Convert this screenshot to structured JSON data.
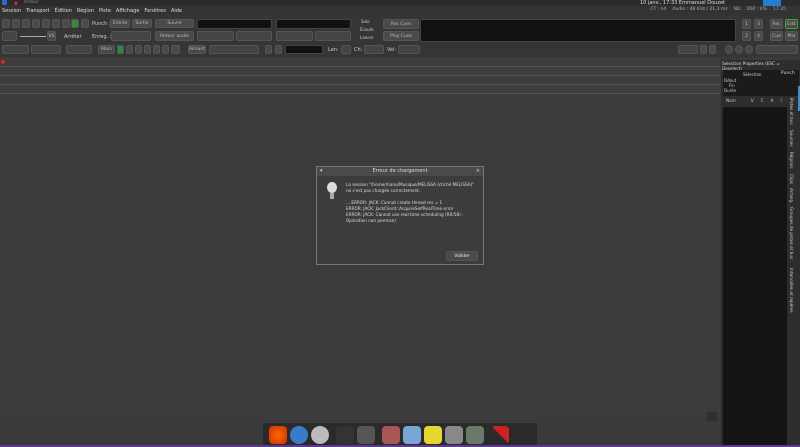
{
  "titlebar": {
    "app": "Ardour",
    "clock": "10 janv., 17:33 Emmanuel Douzet"
  },
  "menu": [
    "Session",
    "Transport",
    "Édition",
    "Région",
    "Piste",
    "Affichage",
    "Fenêtres",
    "Aide"
  ],
  "status": {
    "ct": "CT : nd",
    "audio": "Audio : 48 kHz / 21,3 ms",
    "nd": "ND",
    "dsp": "DSP : 0%",
    "time": "17:35"
  },
  "toolbar": {
    "punch": "Punch :",
    "entree": "Entrée",
    "sortie": "Sortie",
    "suivre": "Suivre",
    "enreg": "Enreg. :",
    "retour": "Retour audio",
    "vs": "VS",
    "arreter": "Arrêter",
    "solo": "Solo",
    "ecoute": "Écoute",
    "lancer": "Lancer",
    "rec_cues": "Rec Cues",
    "play_cues": "Play Cues",
    "rec": "Rec",
    "edit": "Edit",
    "cue": "Cue",
    "mix": "Mix",
    "n1": "1",
    "n2": "2",
    "n3": "3",
    "n4": "4",
    "main": "Main",
    "aimant": "Aimant",
    "len": "Len:",
    "ch": "Ch:",
    "vel": "Vel:"
  },
  "panel": {
    "title": "Selection Properties (ESC = Deselect)",
    "selection": "Sélection",
    "punch": "Punch",
    "debut": "Début",
    "fin": "Fin",
    "duree": "Durée",
    "cols": [
      "Nom",
      "V",
      "C",
      "A",
      "I"
    ],
    "tabs": [
      "Pistes et bus",
      "Sources",
      "Régions",
      "Clips",
      "Arrang.",
      "Groupes de pistes et bus",
      "Intervalles et repères"
    ]
  },
  "dialog": {
    "title": "Erreur de chargement",
    "message": "La session \"/home/manu/Musique/MELISSA (cliché MELISSA)\"\nne s'est pas chargée correctement.\n\n....ERROR: JACK: Cannot create thread res = 1\nERROR: JACK: JackClient::AcquireSelfRealTime error\nERROR: JACK: Cannot use real-time scheduling (RR/58) :\nOpération non permise)",
    "ok": "Valider"
  },
  "dock": [
    "firefox",
    "thunderbird",
    "disk",
    "inkscape",
    "gimp",
    "archive",
    "scan",
    "notes",
    "camera",
    "calculator",
    "ardour"
  ]
}
